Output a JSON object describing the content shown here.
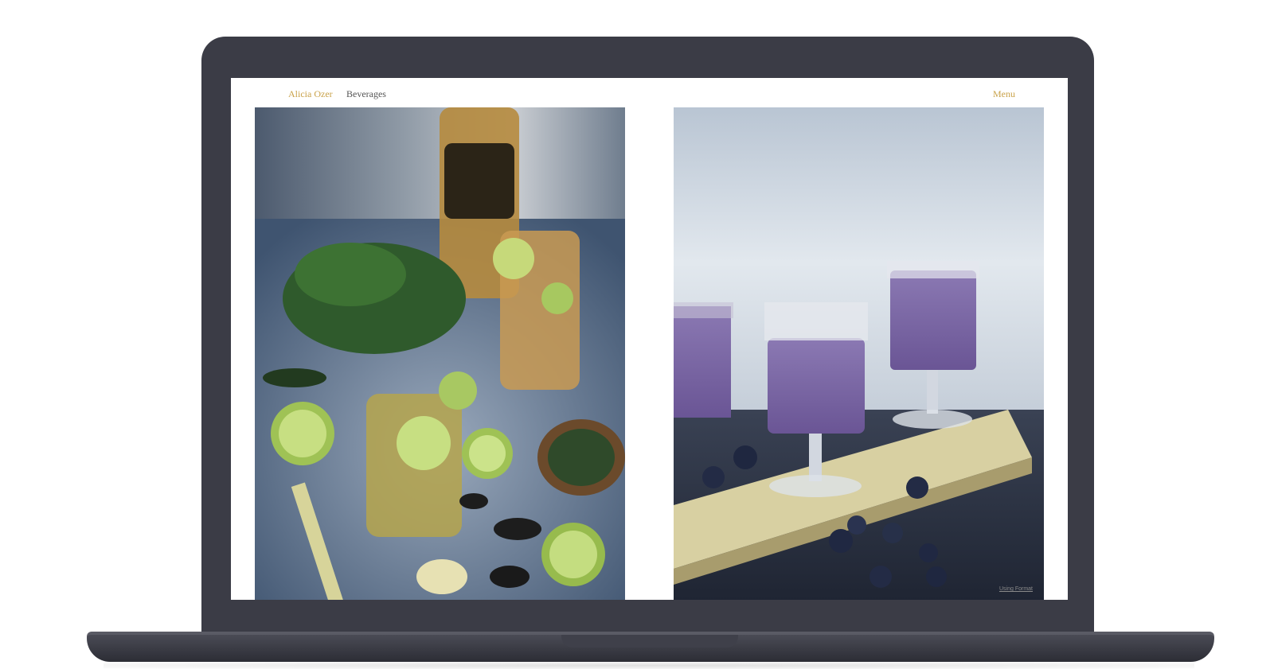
{
  "nav": {
    "brand": "Alicia Ozer",
    "section": "Beverages",
    "menu": "Menu"
  },
  "footer": {
    "credit": "Using Format"
  },
  "photos": [
    {
      "subject": "mojito-cocktails"
    },
    {
      "subject": "blueberry-smoothies"
    }
  ],
  "colors": {
    "accent": "#c9a24a",
    "laptop_body": "#3b3c46",
    "nav_text": "#555555"
  }
}
